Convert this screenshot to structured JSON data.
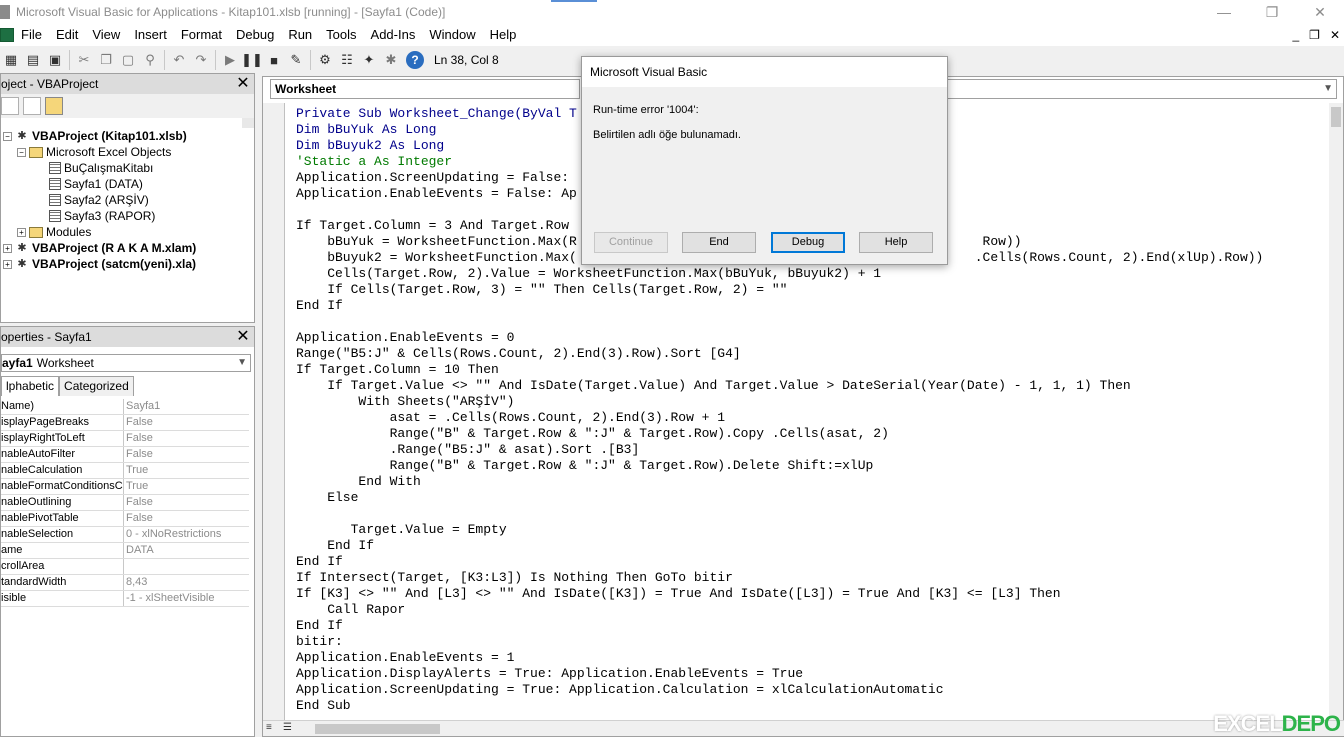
{
  "window": {
    "title": "Microsoft Visual Basic for Applications - Kitap101.xlsb [running] - [Sayfa1 (Code)]",
    "buttons": {
      "minimize": "—",
      "restore": "❐",
      "close": "✕"
    }
  },
  "menu": {
    "items": [
      "File",
      "Edit",
      "View",
      "Insert",
      "Format",
      "Debug",
      "Run",
      "Tools",
      "Add-Ins",
      "Window",
      "Help"
    ],
    "mdi": {
      "minimize": "_",
      "restore": "❐",
      "close": "✕"
    }
  },
  "toolbar": {
    "position": "Ln 38, Col 8"
  },
  "project": {
    "title": "oject - VBAProject",
    "close": "✕",
    "tree": [
      {
        "label": "VBAProject (Kitap101.xlsb)",
        "level": 0,
        "expander": "−",
        "icon": "vba",
        "bold": true
      },
      {
        "label": "Microsoft Excel Objects",
        "level": 1,
        "expander": "−",
        "icon": "folder",
        "bold": false
      },
      {
        "label": "BuÇalışmaKitabı",
        "level": 2,
        "expander": "",
        "icon": "sheet",
        "bold": false
      },
      {
        "label": "Sayfa1 (DATA)",
        "level": 2,
        "expander": "",
        "icon": "sheet",
        "bold": false
      },
      {
        "label": "Sayfa2 (ARŞİV)",
        "level": 2,
        "expander": "",
        "icon": "sheet",
        "bold": false
      },
      {
        "label": "Sayfa3 (RAPOR)",
        "level": 2,
        "expander": "",
        "icon": "sheet",
        "bold": false
      },
      {
        "label": "Modules",
        "level": 1,
        "expander": "+",
        "icon": "folder",
        "bold": false
      },
      {
        "label": "VBAProject (R A K A M.xlam)",
        "level": 0,
        "expander": "+",
        "icon": "vba",
        "bold": true
      },
      {
        "label": "VBAProject (satcm(yeni).xla)",
        "level": 0,
        "expander": "+",
        "icon": "vba",
        "bold": true
      }
    ]
  },
  "properties": {
    "title": "operties - Sayfa1",
    "close": "✕",
    "combo": {
      "name": "ayfa1",
      "type": "Worksheet"
    },
    "tabs": [
      "lphabetic",
      "Categorized"
    ],
    "rows": [
      {
        "name": "Name)",
        "value": "Sayfa1"
      },
      {
        "name": "isplayPageBreaks",
        "value": "False"
      },
      {
        "name": "isplayRightToLeft",
        "value": "False"
      },
      {
        "name": "nableAutoFilter",
        "value": "False"
      },
      {
        "name": "nableCalculation",
        "value": "True"
      },
      {
        "name": "nableFormatConditionsCa",
        "value": "True"
      },
      {
        "name": "nableOutlining",
        "value": "False"
      },
      {
        "name": "nablePivotTable",
        "value": "False"
      },
      {
        "name": "nableSelection",
        "value": "0 - xlNoRestrictions"
      },
      {
        "name": "ame",
        "value": "DATA"
      },
      {
        "name": "crollArea",
        "value": ""
      },
      {
        "name": "tandardWidth",
        "value": "8,43"
      },
      {
        "name": "isible",
        "value": "-1 - xlSheetVisible"
      }
    ]
  },
  "code": {
    "object_combo": "Worksheet",
    "lines": [
      {
        "text": "Private Sub Worksheet_Change(ByVal T",
        "kind": "kw"
      },
      {
        "text": "Dim bBuYuk As Long",
        "kind": "kw"
      },
      {
        "text": "Dim bBuyuk2 As Long",
        "kind": "kw"
      },
      {
        "text": "'Static a As Integer",
        "kind": "cm"
      },
      {
        "text": "Application.ScreenUpdating = False:",
        "kind": "n"
      },
      {
        "text": "Application.EnableEvents = False: Ap",
        "kind": "n"
      },
      {
        "text": "",
        "kind": "n"
      },
      {
        "text": "If Target.Column = 3 And Target.Row",
        "kind": "n"
      },
      {
        "text": "    bBuYuk = WorksheetFunction.Max(R                                                    Row))",
        "kind": "n"
      },
      {
        "text": "    bBuyuk2 = WorksheetFunction.Max(                                                   .Cells(Rows.Count, 2).End(xlUp).Row))",
        "kind": "n"
      },
      {
        "text": "    Cells(Target.Row, 2).Value = WorksheetFunction.Max(bBuYuk, bBuyuk2) + 1",
        "kind": "n"
      },
      {
        "text": "    If Cells(Target.Row, 3) = \"\" Then Cells(Target.Row, 2) = \"\"",
        "kind": "n"
      },
      {
        "text": "End If",
        "kind": "n"
      },
      {
        "text": "",
        "kind": "n"
      },
      {
        "text": "Application.EnableEvents = 0",
        "kind": "n"
      },
      {
        "text": "Range(\"B5:J\" & Cells(Rows.Count, 2).End(3).Row).Sort [G4]",
        "kind": "n"
      },
      {
        "text": "If Target.Column = 10 Then",
        "kind": "n"
      },
      {
        "text": "    If Target.Value <> \"\" And IsDate(Target.Value) And Target.Value > DateSerial(Year(Date) - 1, 1, 1) Then",
        "kind": "n"
      },
      {
        "text": "        With Sheets(\"ARŞİV\")",
        "kind": "n"
      },
      {
        "text": "            asat = .Cells(Rows.Count, 2).End(3).Row + 1",
        "kind": "n"
      },
      {
        "text": "            Range(\"B\" & Target.Row & \":J\" & Target.Row).Copy .Cells(asat, 2)",
        "kind": "n"
      },
      {
        "text": "            .Range(\"B5:J\" & asat).Sort .[B3]",
        "kind": "n"
      },
      {
        "text": "            Range(\"B\" & Target.Row & \":J\" & Target.Row).Delete Shift:=xlUp",
        "kind": "n"
      },
      {
        "text": "        End With",
        "kind": "n"
      },
      {
        "text": "    Else",
        "kind": "n"
      },
      {
        "text": "",
        "kind": "n"
      },
      {
        "text": "       Target.Value = Empty",
        "kind": "n"
      },
      {
        "text": "    End If",
        "kind": "n"
      },
      {
        "text": "End If",
        "kind": "n"
      },
      {
        "text": "If Intersect(Target, [K3:L3]) Is Nothing Then GoTo bitir",
        "kind": "n"
      },
      {
        "text": "If [K3] <> \"\" And [L3] <> \"\" And IsDate([K3]) = True And IsDate([L3]) = True And [K3] <= [L3] Then",
        "kind": "n"
      },
      {
        "text": "    Call Rapor",
        "kind": "n"
      },
      {
        "text": "End If",
        "kind": "n"
      },
      {
        "text": "bitir:",
        "kind": "n"
      },
      {
        "text": "Application.EnableEvents = 1",
        "kind": "n"
      },
      {
        "text": "Application.DisplayAlerts = True: Application.EnableEvents = True",
        "kind": "n"
      },
      {
        "text": "Application.ScreenUpdating = True: Application.Calculation = xlCalculationAutomatic",
        "kind": "n"
      },
      {
        "text": "End Sub",
        "kind": "n"
      }
    ]
  },
  "dialog": {
    "title": "Microsoft Visual Basic",
    "message1": "Run-time error '1004':",
    "message2": "Belirtilen adlı öğe bulunamadı.",
    "buttons": {
      "continue": "Continue",
      "end": "End",
      "debug": "Debug",
      "help": "Help"
    }
  },
  "watermark": {
    "a": "EXCEL",
    "b": "DEPO"
  }
}
